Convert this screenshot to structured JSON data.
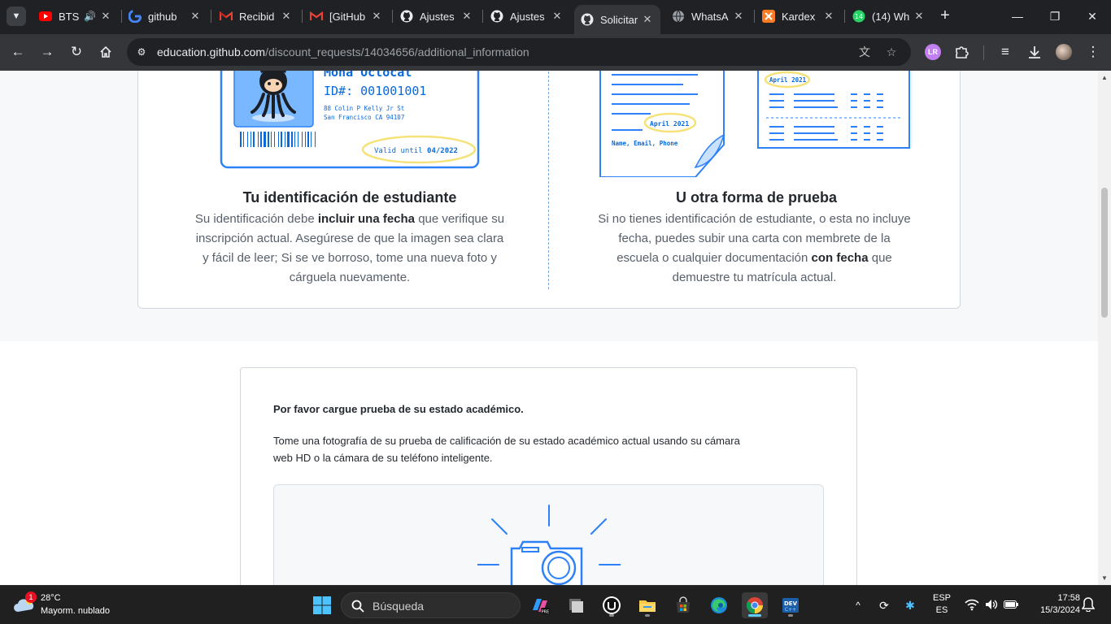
{
  "browser": {
    "tabs": [
      {
        "title": "BTS",
        "favicon": "youtube-icon",
        "audio": true
      },
      {
        "title": "github",
        "favicon": "google-icon"
      },
      {
        "title": "Recibid",
        "favicon": "gmail-icon"
      },
      {
        "title": "[GitHub",
        "favicon": "gmail-icon"
      },
      {
        "title": "Ajustes",
        "favicon": "github-icon"
      },
      {
        "title": "Ajustes",
        "favicon": "github-icon"
      },
      {
        "title": "Solicitar",
        "favicon": "github-icon",
        "active": true
      },
      {
        "title": "WhatsA",
        "favicon": "globe-icon"
      },
      {
        "title": "Kardex",
        "favicon": "xampp-icon"
      },
      {
        "title": "(14) Wh",
        "favicon": "whatsapp-icon",
        "badge": "14"
      }
    ],
    "address": {
      "host": "education.github.com",
      "path": "/discount_requests/14034656/additional_information"
    }
  },
  "page": {
    "id_card": {
      "name": "Mona Octocat",
      "id_line": "ID#: 001001001",
      "address1": "88 Colin P Kelly Jr St",
      "address2": "San Francisco CA 94107",
      "valid_prefix": "Valid until ",
      "valid_date": "04/2022"
    },
    "letter": {
      "date1": "April 2021",
      "date2": "April 2021",
      "footer": "Name, Email, Phone"
    },
    "left": {
      "title": "Tu identificación de estudiante",
      "text_before": "Su identificación debe ",
      "text_bold": "incluir una fecha",
      "text_after": " que verifique su inscripción actual. Asegúrese de que la imagen sea clara y fácil de leer; Si se ve borroso, tome una nueva foto y cárguela nuevamente."
    },
    "right": {
      "title": "U otra forma de prueba",
      "text_before": "Si no tienes identificación de estudiante, o esta no incluye fecha, puedes subir una carta con membrete de la escuela o cualquier documentación ",
      "text_bold": "con fecha",
      "text_after": " que demuestre tu matrícula actual."
    },
    "upload": {
      "title": "Por favor cargue prueba de su estado académico.",
      "description": "Tome una fotografía de su prueba de calificación de su estado académico actual usando su cámara web HD o la cámara de su teléfono inteligente."
    }
  },
  "taskbar": {
    "weather": {
      "badge": "1",
      "temp": "28°C",
      "desc": "Mayorm. nublado"
    },
    "search_label": "Búsqueda",
    "language": {
      "code": "ESP",
      "layout": "ES"
    },
    "clock": {
      "time": "17:58",
      "date": "15/3/2024"
    }
  },
  "colors": {
    "brand_blue": "#0969da",
    "illustration_blue": "#2f81f7",
    "highlight_yellow": "#f5e27a"
  }
}
